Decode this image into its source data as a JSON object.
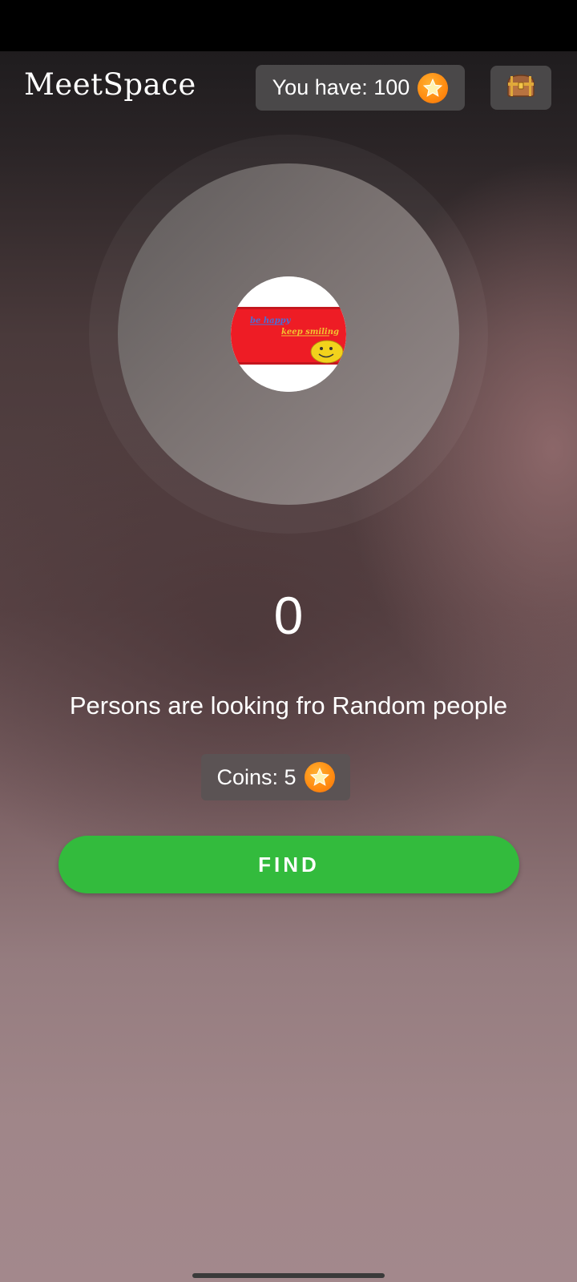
{
  "header": {
    "app_title": "MeetSpace",
    "balance_text": "You have: 100",
    "coin_icon": "star-coin-icon",
    "chest_icon": "treasure-chest-icon"
  },
  "profile": {
    "image_text_top": "be happy",
    "image_text_bottom": "keep smiling"
  },
  "search": {
    "count": "0",
    "caption": "Persons are looking fro Random people",
    "cost_text": "Coins: 5",
    "find_label": "FIND"
  },
  "colors": {
    "accent_green": "#33bb3d",
    "coin_orange": "#ff8a10",
    "logo_red": "#ee1c25"
  }
}
